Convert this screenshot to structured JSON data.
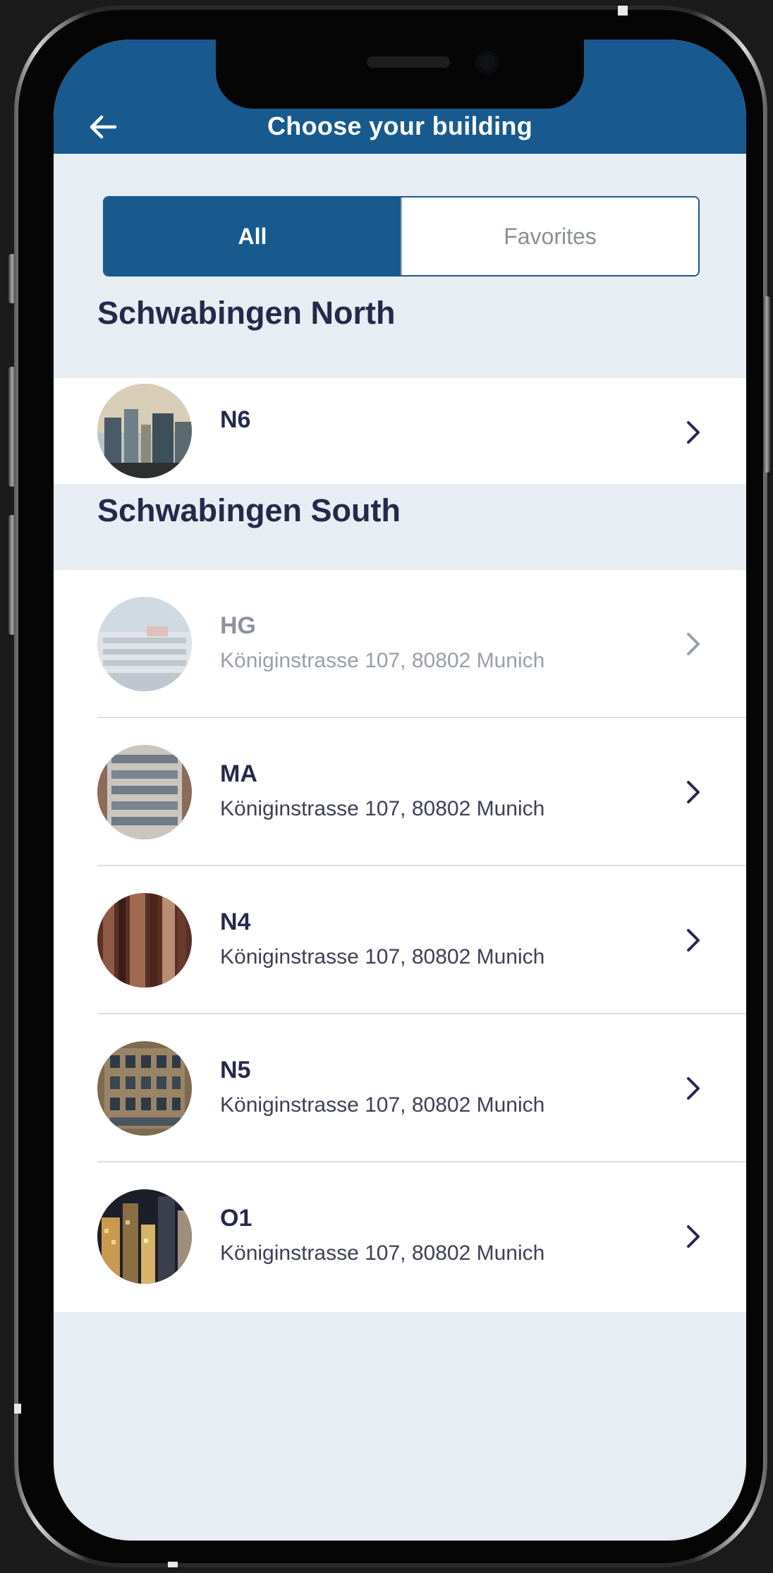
{
  "header": {
    "title": "Choose your building",
    "back_icon": "arrow-left-icon"
  },
  "tabs": [
    {
      "label": "All",
      "selected": true
    },
    {
      "label": "Favorites",
      "selected": false
    }
  ],
  "sections": [
    {
      "heading": "Schwabingen North",
      "buildings": [
        {
          "name": "N6",
          "address": "",
          "disabled": false
        }
      ]
    },
    {
      "heading": "Schwabingen South",
      "buildings": [
        {
          "name": "HG",
          "address": "Königinstrasse 107, 80802 Munich",
          "disabled": true
        },
        {
          "name": "MA",
          "address": "Königinstrasse 107, 80802 Munich",
          "disabled": false
        },
        {
          "name": "N4",
          "address": "Königinstrasse 107, 80802 Munich",
          "disabled": false
        },
        {
          "name": "N5",
          "address": "Königinstrasse 107, 80802 Munich",
          "disabled": false
        },
        {
          "name": "O1",
          "address": "Königinstrasse 107, 80802 Munich",
          "disabled": false
        }
      ]
    }
  ],
  "colors": {
    "brand": "#195a8e",
    "background": "#e7edf3",
    "heading_text": "#26294a",
    "disabled_text": "#8d919e"
  }
}
